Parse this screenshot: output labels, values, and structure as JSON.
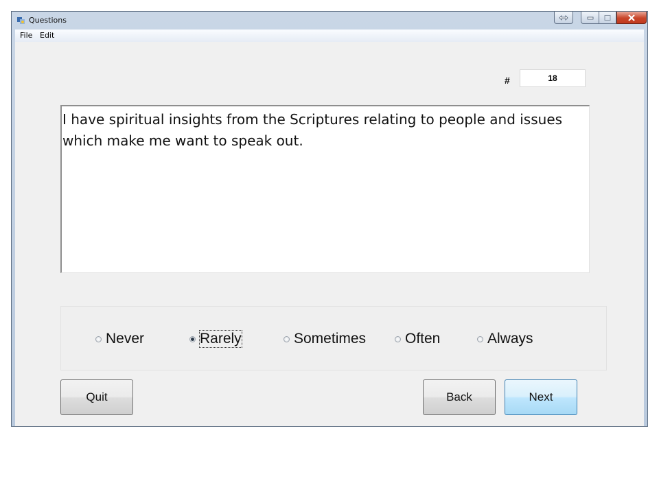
{
  "window": {
    "title": "Questions",
    "app_icon": "app-icon",
    "controls": [
      "resize-icon",
      "minimize-icon",
      "maximize-icon",
      "close-icon"
    ]
  },
  "menu": {
    "items": [
      {
        "label": "File"
      },
      {
        "label": "Edit"
      }
    ]
  },
  "question": {
    "number_label": "#",
    "number": "18",
    "text": "I have spiritual insights from the Scriptures relating to people and issues which make me want to speak out."
  },
  "options": [
    {
      "label": "Never",
      "checked": false
    },
    {
      "label": "Rarely",
      "checked": true
    },
    {
      "label": "Sometimes",
      "checked": false
    },
    {
      "label": "Often",
      "checked": false
    },
    {
      "label": "Always",
      "checked": false
    }
  ],
  "buttons": {
    "quit": "Quit",
    "back": "Back",
    "next": "Next"
  },
  "colors": {
    "close_button": "#c8452a",
    "default_button": "#bee6fd"
  }
}
